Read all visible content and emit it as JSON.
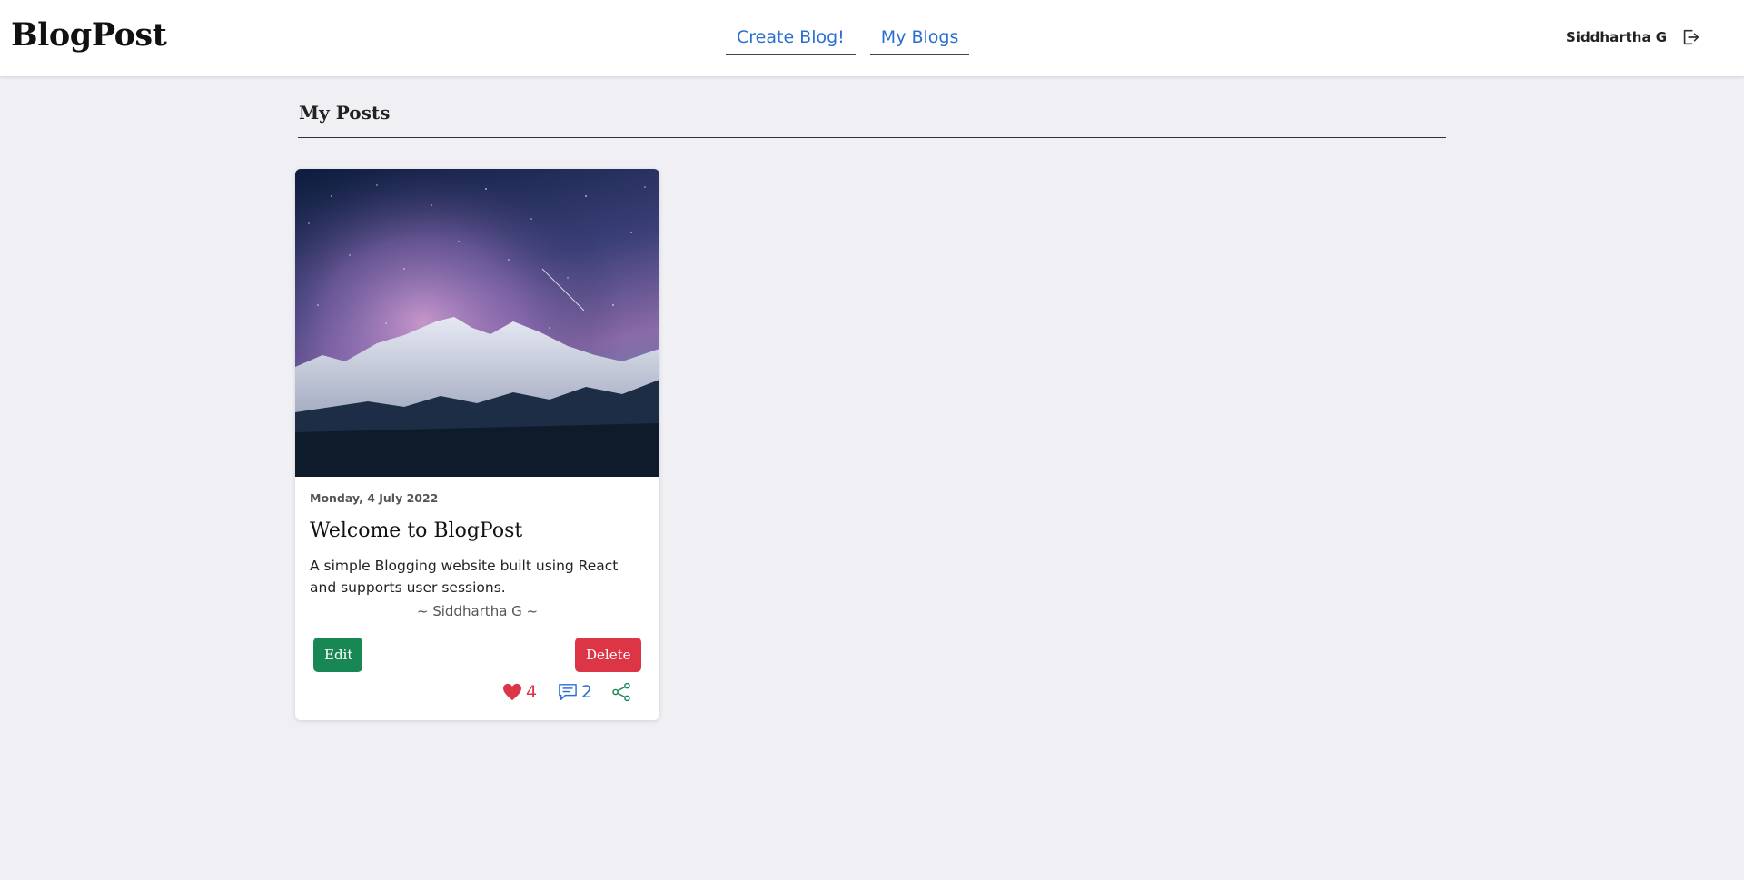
{
  "brand": "BlogPost",
  "nav": {
    "links": [
      {
        "label": "Create Blog!"
      },
      {
        "label": "My Blogs"
      }
    ]
  },
  "user": {
    "name": "Siddhartha G",
    "logout_icon": "logout-icon"
  },
  "page": {
    "section_title": "My Posts"
  },
  "posts": [
    {
      "date": "Monday, 4 July 2022",
      "title": "Welcome to BlogPost",
      "description": "A simple Blogging website built using React and supports user sessions.",
      "author": "~ Siddhartha G ~",
      "image": "night-sky-mountains",
      "edit_label": "Edit",
      "delete_label": "Delete",
      "likes": "4",
      "comments": "2",
      "icons": {
        "like": "heart-icon",
        "comment": "comment-icon",
        "share": "share-icon"
      }
    }
  ],
  "colors": {
    "accent": "#2b6fd1",
    "edit": "#198754",
    "delete": "#dc3545",
    "background": "#efeff4"
  }
}
